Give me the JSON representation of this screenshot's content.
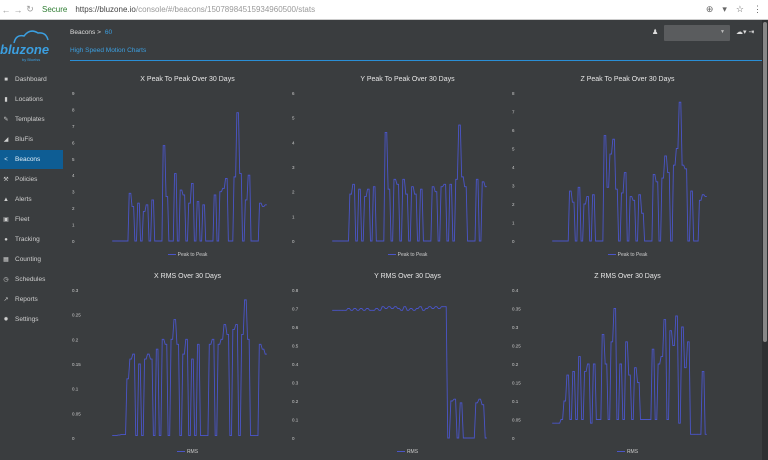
{
  "browser": {
    "secure_label": "Secure",
    "url_host": "https://bluzone.io",
    "url_path": "/console/#/beacons/150789845159349605​00/stats"
  },
  "logo": {
    "word": "bluzone",
    "by": "by Blueiss"
  },
  "sidebar": {
    "items": [
      {
        "label": "Dashboard",
        "icon": "home-icon",
        "glyph": "■"
      },
      {
        "label": "Locations",
        "icon": "building-icon",
        "glyph": "▮"
      },
      {
        "label": "Templates",
        "icon": "wrench-icon",
        "glyph": "✎"
      },
      {
        "label": "BluFis",
        "icon": "signal-icon",
        "glyph": "◢"
      },
      {
        "label": "Beacons",
        "icon": "share-icon",
        "glyph": "<",
        "active": true
      },
      {
        "label": "Policies",
        "icon": "gavel-icon",
        "glyph": "⚒"
      },
      {
        "label": "Alerts",
        "icon": "bell-icon",
        "glyph": "▲"
      },
      {
        "label": "Fleet",
        "icon": "truck-icon",
        "glyph": "▣"
      },
      {
        "label": "Tracking",
        "icon": "pin-icon",
        "glyph": "●"
      },
      {
        "label": "Counting",
        "icon": "calculator-icon",
        "glyph": "▦"
      },
      {
        "label": "Schedules",
        "icon": "clock-icon",
        "glyph": "◷"
      },
      {
        "label": "Reports",
        "icon": "chart-icon",
        "glyph": "↗"
      },
      {
        "label": "Settings",
        "icon": "gear-icon",
        "glyph": "✹"
      }
    ]
  },
  "header": {
    "breadcrumb_root": "Beacons",
    "breadcrumb_sep": ">",
    "breadcrumb_current": "60",
    "subtitle": "High Speed Motion Charts"
  },
  "colors": {
    "accent": "#3b9fe0",
    "active_nav": "#0e5d94",
    "series": "#4a55c8",
    "background": "#3a3d3f"
  },
  "chart_data": [
    {
      "type": "line",
      "title": "X Peak To Peak Over 30 Days",
      "legend": "Peak to Peak",
      "ylim": [
        0,
        9
      ],
      "yticks": [
        "0",
        "1",
        "2",
        "3",
        "4",
        "5",
        "6",
        "7",
        "8",
        "9"
      ],
      "grid": false,
      "legend_position": "bottom",
      "values": [
        0,
        0,
        0,
        0,
        0,
        0,
        2.9,
        2.1,
        0,
        2.3,
        0,
        1.8,
        2.2,
        0,
        2.5,
        0,
        0,
        0,
        5.8,
        2.7,
        0,
        0,
        4.1,
        0,
        3.1,
        2.8,
        0,
        2.3,
        3.5,
        0,
        2.4,
        0,
        2.2,
        0,
        0,
        0,
        2.8,
        0,
        3.0,
        3.2,
        3.8,
        0,
        0,
        3.9,
        7.8,
        4.1,
        0,
        2.5,
        4.0,
        0,
        0,
        0,
        2.3,
        2.1,
        2.2
      ]
    },
    {
      "type": "line",
      "title": "Y Peak To Peak Over 30 Days",
      "legend": "Peak to Peak",
      "ylim": [
        0,
        6
      ],
      "yticks": [
        "0",
        "1",
        "2",
        "3",
        "4",
        "5",
        "6"
      ],
      "grid": false,
      "legend_position": "bottom",
      "values": [
        0,
        0,
        0,
        0,
        0,
        0,
        1.9,
        2.3,
        0,
        2.1,
        0,
        1.8,
        2.1,
        0,
        2.2,
        0,
        0,
        0,
        4.4,
        2.1,
        0,
        2.5,
        2.3,
        0,
        2.5,
        1.9,
        0,
        2.2,
        1.9,
        0,
        2.1,
        0,
        0,
        0,
        2.2,
        2.0,
        0,
        2.2,
        2.3,
        0,
        2.3,
        0,
        2.5,
        4.7,
        2.6,
        2.2,
        0,
        0,
        0,
        2.5,
        0,
        2.4,
        2.2
      ]
    },
    {
      "type": "line",
      "title": "Z Peak To Peak Over 30 Days",
      "legend": "Peak to Peak",
      "ylim": [
        0,
        8
      ],
      "yticks": [
        "0",
        "1",
        "2",
        "3",
        "4",
        "5",
        "6",
        "7",
        "8"
      ],
      "grid": false,
      "legend_position": "bottom",
      "values": [
        0,
        0,
        0,
        0,
        0,
        0,
        2.7,
        2.1,
        0,
        2.9,
        0,
        2.0,
        2.4,
        0,
        2.5,
        0,
        0,
        0,
        5.7,
        2.9,
        4.7,
        5.5,
        2.8,
        0,
        2.6,
        3.7,
        0,
        2.4,
        2.2,
        0,
        2.5,
        1.5,
        0,
        0,
        0,
        3.6,
        3.2,
        0,
        3.4,
        4.6,
        3.7,
        0,
        4.1,
        5.0,
        7.5,
        4.1,
        3.9,
        0,
        2.7,
        0,
        0,
        2.2,
        2.5,
        2.4
      ]
    },
    {
      "type": "line",
      "title": "X RMS Over 30 Days",
      "legend": "RMS",
      "ylim": [
        0,
        0.3
      ],
      "yticks": [
        "0",
        "0.05",
        "0.1",
        "0.15",
        "0.2",
        "0.25",
        "0.3"
      ],
      "grid": false,
      "legend_position": "bottom",
      "values": [
        0.005,
        0.005,
        0.006,
        0.007,
        0.007,
        0.12,
        0.16,
        0.17,
        0.005,
        0.15,
        0.005,
        0.16,
        0.17,
        0.16,
        0.005,
        0.18,
        0.005,
        0.2,
        0.19,
        0.005,
        0.2,
        0.24,
        0.19,
        0.005,
        0.17,
        0.2,
        0.005,
        0.16,
        0.005,
        0.19,
        0.005,
        0.005,
        0.005,
        0.19,
        0.2,
        0.005,
        0.19,
        0.2,
        0.23,
        0.21,
        0.005,
        0.22,
        0.23,
        0.005,
        0.21,
        0.28,
        0.2,
        0.005,
        0.005,
        0.005,
        0.19,
        0.18,
        0.17
      ]
    },
    {
      "type": "line",
      "title": "Y RMS Over 30 Days",
      "legend": "RMS",
      "ylim": [
        0,
        0.8
      ],
      "yticks": [
        "0",
        "0.1",
        "0.2",
        "0.3",
        "0.4",
        "0.5",
        "0.6",
        "0.7",
        "0.8"
      ],
      "grid": false,
      "legend_position": "bottom",
      "values": [
        0.69,
        0.69,
        0.69,
        0.69,
        0.69,
        0.7,
        0.69,
        0.7,
        0.69,
        0.7,
        0.69,
        0.7,
        0.69,
        0.69,
        0.7,
        0.69,
        0.71,
        0.7,
        0.71,
        0.7,
        0.71,
        0.7,
        0.69,
        0.71,
        0.69,
        0.7,
        0.69,
        0.7,
        0.71,
        0.69,
        0.7,
        0.71,
        0.7,
        0.71,
        0.7,
        0.71,
        0.71,
        0,
        0.2,
        0.21,
        0,
        0.19,
        0,
        0,
        0,
        0,
        0.19,
        0.21,
        0.18,
        0
      ]
    },
    {
      "type": "line",
      "title": "Z RMS Over 30 Days",
      "legend": "RMS",
      "ylim": [
        0,
        0.4
      ],
      "yticks": [
        "0",
        "0.05",
        "0.1",
        "0.15",
        "0.2",
        "0.25",
        "0.3",
        "0.35",
        "0.4"
      ],
      "grid": false,
      "legend_position": "bottom",
      "values": [
        0.04,
        0.04,
        0.04,
        0.05,
        0.1,
        0.17,
        0.05,
        0.18,
        0.05,
        0.22,
        0.05,
        0.18,
        0.2,
        0.04,
        0.2,
        0.05,
        0.05,
        0.28,
        0.2,
        0.05,
        0.26,
        0.35,
        0.05,
        0.2,
        0.05,
        0.26,
        0.17,
        0.05,
        0.19,
        0.15,
        0.05,
        0.05,
        0.05,
        0.05,
        0.24,
        0.05,
        0.2,
        0.22,
        0.32,
        0.05,
        0.29,
        0.25,
        0.33,
        0.04,
        0.3,
        0.19,
        0.26,
        0.01,
        0.01,
        0.01,
        0.01,
        0.18,
        0.01
      ]
    }
  ]
}
